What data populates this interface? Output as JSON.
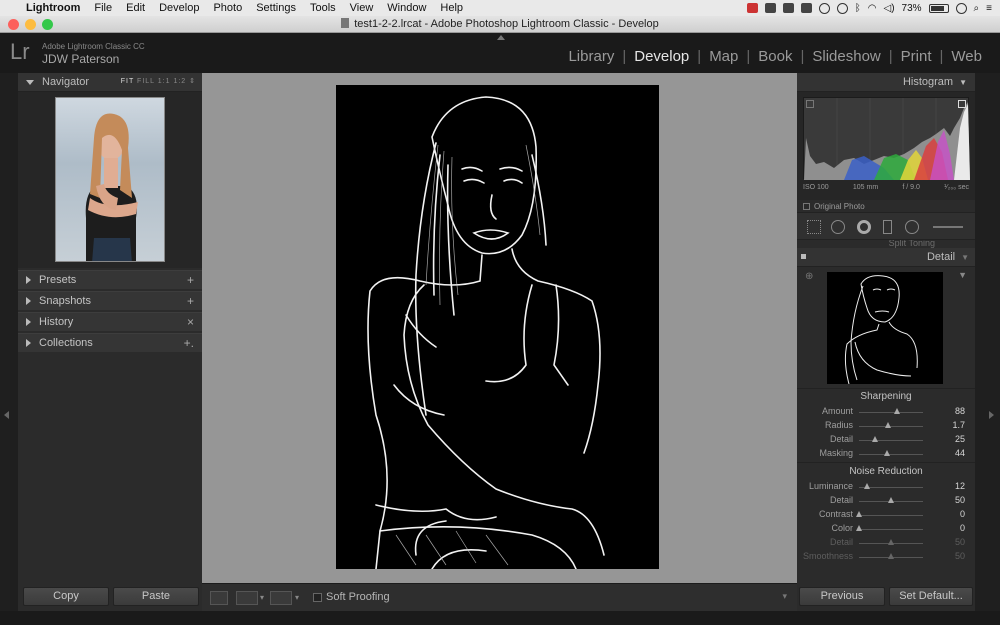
{
  "menubar": {
    "items": [
      "Lightroom",
      "File",
      "Edit",
      "Develop",
      "Photo",
      "Settings",
      "Tools",
      "View",
      "Window",
      "Help"
    ],
    "battery": "73%"
  },
  "window": {
    "title": "test1-2-2.lrcat - Adobe Photoshop Lightroom Classic - Develop"
  },
  "identity": {
    "logo": "Lr",
    "product": "Adobe Lightroom Classic CC",
    "user": "JDW Paterson"
  },
  "modules": [
    "Library",
    "Develop",
    "Map",
    "Book",
    "Slideshow",
    "Print",
    "Web"
  ],
  "active_module": "Develop",
  "navigator": {
    "title": "Navigator",
    "zoom": [
      "FIT",
      "FILL",
      "1:1",
      "1:2"
    ]
  },
  "left_panels": [
    {
      "label": "Presets",
      "action": "+"
    },
    {
      "label": "Snapshots",
      "action": "+"
    },
    {
      "label": "History",
      "action": "×"
    },
    {
      "label": "Collections",
      "action": "+."
    }
  ],
  "left_buttons": {
    "copy": "Copy",
    "paste": "Paste"
  },
  "toolbar": {
    "soft_proofing": "Soft Proofing"
  },
  "histogram": {
    "title": "Histogram",
    "iso": "ISO 100",
    "focal": "105 mm",
    "aperture": "f / 9.0",
    "shutter": "¹⁄₂₀₀ sec",
    "original_photo": "Original Photo"
  },
  "detail": {
    "partial_title": "Split Toning",
    "title": "Detail",
    "sharpening_title": "Sharpening",
    "sharpening": [
      {
        "label": "Amount",
        "value": "88",
        "pos": 0.6
      },
      {
        "label": "Radius",
        "value": "1.7",
        "pos": 0.45
      },
      {
        "label": "Detail",
        "value": "25",
        "pos": 0.25
      },
      {
        "label": "Masking",
        "value": "44",
        "pos": 0.44
      }
    ],
    "noise_title": "Noise Reduction",
    "noise": [
      {
        "label": "Luminance",
        "value": "12",
        "pos": 0.12,
        "dim": false
      },
      {
        "label": "Detail",
        "value": "50",
        "pos": 0.5,
        "dim": false
      },
      {
        "label": "Contrast",
        "value": "0",
        "pos": 0.0,
        "dim": false
      },
      {
        "label": "Color",
        "value": "0",
        "pos": 0.0,
        "dim": false
      },
      {
        "label": "Detail",
        "value": "50",
        "pos": 0.5,
        "dim": true
      },
      {
        "label": "Smoothness",
        "value": "50",
        "pos": 0.5,
        "dim": true
      }
    ]
  },
  "right_buttons": {
    "previous": "Previous",
    "set_default": "Set Default..."
  },
  "colors": {
    "background": "#1a1a1a",
    "panel": "#2b2b2b",
    "canvas": "#969696"
  }
}
